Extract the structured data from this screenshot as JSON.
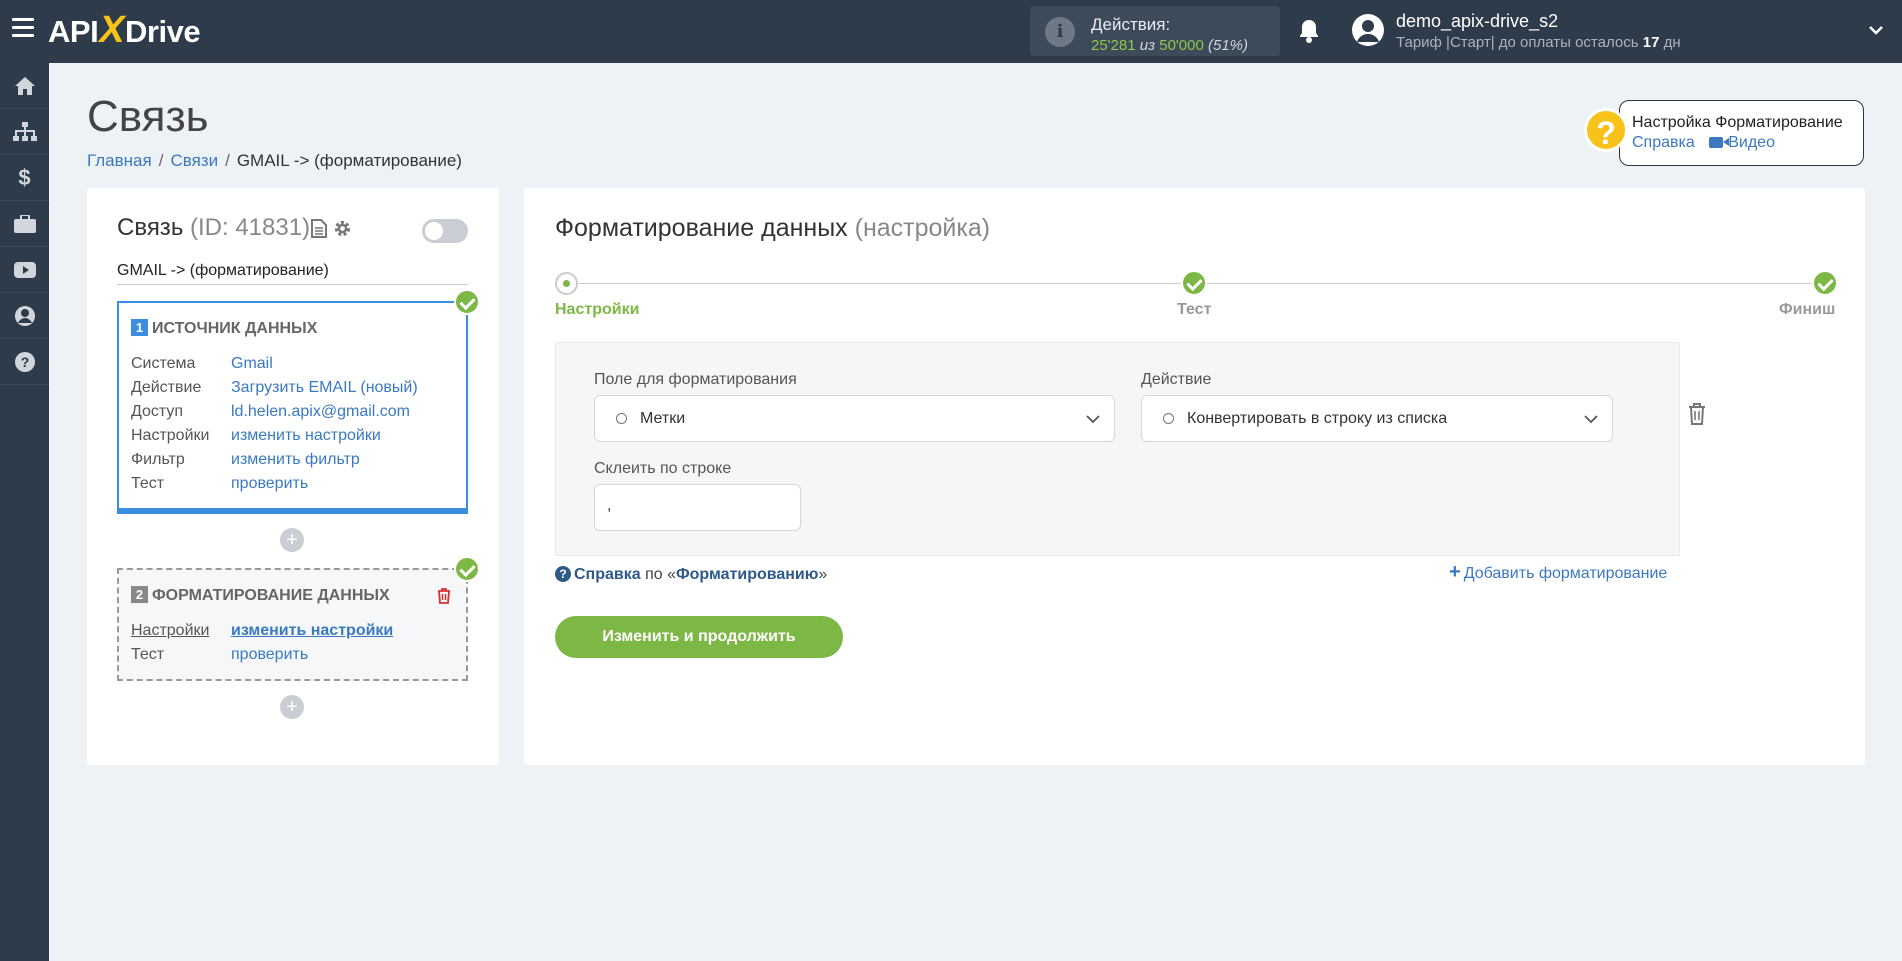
{
  "header": {
    "logo_text_left": "API",
    "logo_text_x": "X",
    "logo_text_right": "Drive",
    "actions_label": "Действия:",
    "actions_used": "25'281",
    "actions_of": "из",
    "actions_total": "50'000",
    "actions_percent": "(51%)",
    "user_name": "demo_apix-drive_s2",
    "plan_prefix": "Тариф |Старт| до оплаты осталось",
    "plan_days": "17",
    "plan_suffix": "дн"
  },
  "sidebar": {
    "items": [
      "home-icon",
      "sitemap-icon",
      "dollar-icon",
      "briefcase-icon",
      "youtube-icon",
      "user-icon",
      "help-icon"
    ]
  },
  "page": {
    "title": "Связь",
    "breadcrumb": [
      "Главная",
      "Связи",
      "GMAIL -> (форматирование)"
    ]
  },
  "help_box": {
    "title": "Настройка Форматирование",
    "link_help": "Справка",
    "link_video": "Видео"
  },
  "connection": {
    "title": "Связь",
    "id_text": "(ID: 41831)",
    "name": "GMAIL -> (форматирование)",
    "source": {
      "number": "1",
      "header": "ИСТОЧНИК ДАННЫХ",
      "rows": [
        {
          "k": "Система",
          "v": "Gmail"
        },
        {
          "k": "Действие",
          "v": "Загрузить EMAIL (новый)"
        },
        {
          "k": "Доступ",
          "v": "ld.helen.apix@gmail.com"
        },
        {
          "k": "Настройки",
          "v": "изменить настройки"
        },
        {
          "k": "Фильтр",
          "v": "изменить фильтр"
        },
        {
          "k": "Тест",
          "v": "проверить"
        }
      ]
    },
    "formatting": {
      "number": "2",
      "header": "ФОРМАТИРОВАНИЕ ДАННЫХ",
      "rows": [
        {
          "k": "Настройки",
          "v": "изменить настройки"
        },
        {
          "k": "Тест",
          "v": "проверить"
        }
      ]
    }
  },
  "main": {
    "title": "Форматирование данных",
    "subtitle": "(настройка)",
    "steps": [
      "Настройки",
      "Тест",
      "Финиш"
    ],
    "field_label": "Поле для форматирования",
    "field_value": "Метки",
    "action_label": "Действие",
    "action_value": "Конвертировать в строку из списка",
    "join_label": "Склеить по строке",
    "join_value": ",",
    "help_prefix": "Справка",
    "help_mid": "по «",
    "help_link": "Форматированию",
    "help_end": "»",
    "add_formatting": "Добавить форматирование",
    "submit": "Изменить и продолжить"
  },
  "colors": {
    "topbar": "#2e3b4a",
    "accent_green": "#7db846",
    "link_blue": "#3a79c0",
    "source_border": "#3a8de0",
    "logo_yellow": "#f7c21a"
  }
}
